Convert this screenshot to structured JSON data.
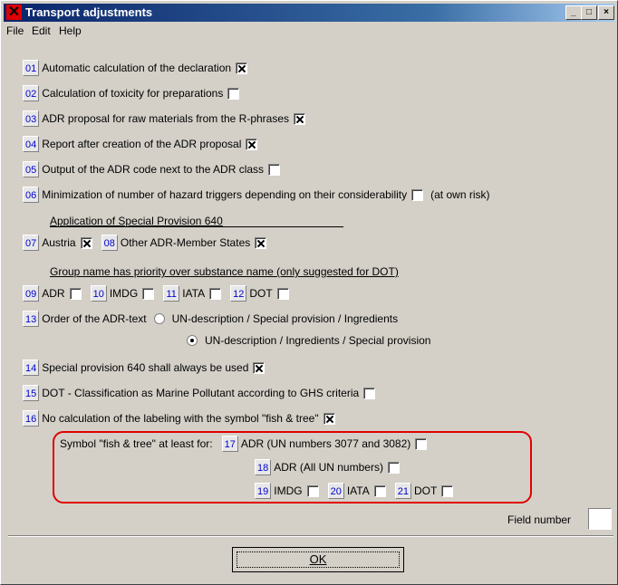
{
  "window": {
    "title": "Transport adjustments",
    "minimize": "_",
    "maximize": "□",
    "close": "×"
  },
  "menu": {
    "file": "File",
    "edit": "Edit",
    "help": "Help"
  },
  "options": [
    {
      "num": "01",
      "label": "Automatic calculation of the declaration",
      "checked": true
    },
    {
      "num": "02",
      "label": "Calculation of toxicity for preparations",
      "checked": false
    },
    {
      "num": "03",
      "label": "ADR proposal for raw materials from the R-phrases",
      "checked": true
    },
    {
      "num": "04",
      "label": "Report after creation of the ADR proposal",
      "checked": true
    },
    {
      "num": "05",
      "label": "Output of the ADR code next to the ADR class",
      "checked": false
    },
    {
      "num": "06",
      "label": "Minimization of number of hazard triggers depending on their considerability",
      "checked": false,
      "suffix": "(at own risk)"
    }
  ],
  "sp640": {
    "heading": "Application of Special Provision 640",
    "austria": {
      "num": "07",
      "label": "Austria",
      "checked": true
    },
    "other": {
      "num": "08",
      "label": "Other ADR-Member States",
      "checked": true
    }
  },
  "group": {
    "heading": "Group name has priority over substance name (only suggested for DOT)",
    "items": [
      {
        "num": "09",
        "label": "ADR",
        "checked": false
      },
      {
        "num": "10",
        "label": "IMDG",
        "checked": false
      },
      {
        "num": "11",
        "label": "IATA",
        "checked": false
      },
      {
        "num": "12",
        "label": "DOT",
        "checked": false
      }
    ]
  },
  "order": {
    "num": "13",
    "label": "Order of the ADR-text",
    "opt1": "UN-description / Special provision / Ingredients",
    "opt2": "UN-description / Ingredients / Special provision",
    "selected": 2
  },
  "more": [
    {
      "num": "14",
      "label": "Special provision 640 shall always be used",
      "checked": true
    },
    {
      "num": "15",
      "label": "DOT - Classification as Marine Pollutant according to GHS criteria",
      "checked": false
    },
    {
      "num": "16",
      "label": "No calculation of the labeling with the symbol \"fish & tree\"",
      "checked": true
    }
  ],
  "fish": {
    "label": "Symbol \"fish & tree\" at least for:",
    "i17": {
      "num": "17",
      "label": "ADR (UN numbers 3077 and 3082)",
      "checked": false
    },
    "i18": {
      "num": "18",
      "label": "ADR (All UN numbers)",
      "checked": false
    },
    "i19": {
      "num": "19",
      "label": "IMDG",
      "checked": false
    },
    "i20": {
      "num": "20",
      "label": "IATA",
      "checked": false
    },
    "i21": {
      "num": "21",
      "label": "DOT",
      "checked": false
    }
  },
  "field": {
    "label": "Field number",
    "value": ""
  },
  "ok": "OK"
}
